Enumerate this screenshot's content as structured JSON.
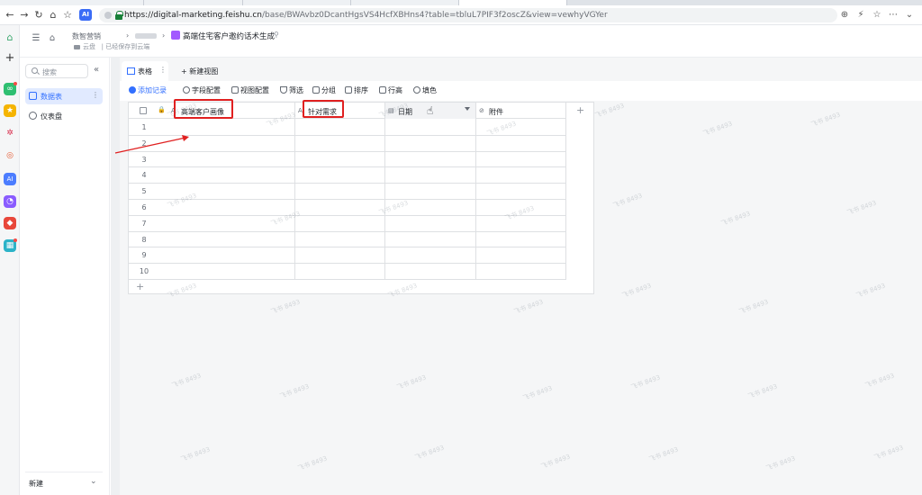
{
  "browser": {
    "url_host": "https://digital-marketing.feishu.cn",
    "url_path": "/base/BWAvbz0DcantHgsVS4HcfXBHns4?table=tbluL7PIF3f2oscZ&view=vewhyVGYer",
    "ai_badge": "AI"
  },
  "header": {
    "breadcrumb_root": "数智营销",
    "doc_title": "高端住宅客户邀约话术生成",
    "sub_breadcrumb": "云盘",
    "saved_status": "已经保存到云端"
  },
  "sidebar": {
    "search_placeholder": "搜索",
    "items": [
      {
        "label": "数据表",
        "active": true
      },
      {
        "label": "仪表盘",
        "active": false
      }
    ],
    "new_label": "新建"
  },
  "views": {
    "active_tab": "表格",
    "new_view": "+ 新建视图"
  },
  "toolbar": {
    "add_record": "添加记录",
    "field_config": "字段配置",
    "view_config": "视图配置",
    "filter": "筛选",
    "group": "分组",
    "sort": "排序",
    "row_height": "行高",
    "fill_color": "填色"
  },
  "table": {
    "columns": [
      {
        "icon": "A",
        "name": "高端客户画像"
      },
      {
        "icon": "A",
        "name": "针对需求"
      },
      {
        "icon": "▤",
        "name": "日期"
      },
      {
        "icon": "⊘",
        "name": "附件"
      }
    ],
    "rows": [
      "1",
      "2",
      "3",
      "4",
      "5",
      "6",
      "7",
      "8",
      "9",
      "10"
    ]
  },
  "colors": {
    "accent": "#3370ff",
    "annotation": "#e02020"
  },
  "watermark_text": "飞书 8493"
}
